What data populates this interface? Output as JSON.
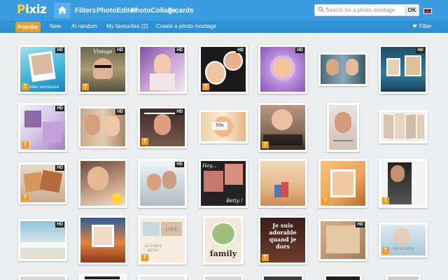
{
  "brand": {
    "logo_p": "P",
    "logo_rest": "ixiz"
  },
  "nav": {
    "links": [
      {
        "label": "Filters"
      },
      {
        "label": "PhotoEditor"
      },
      {
        "label": "PhotoCollage"
      },
      {
        "label": "E-cards"
      }
    ]
  },
  "search": {
    "placeholder": "Search for a photo montage",
    "button": "OK"
  },
  "subnav": {
    "popular": "Popular",
    "new": "New",
    "random": "At random",
    "favourites": "My favourites (2)",
    "create": "Create a photo montage",
    "filter": "Filter"
  },
  "thumbs": {
    "t1_text": "home vacances",
    "t2_text": "Vintage",
    "t10_text": "Me",
    "t17_text1": "Hey...",
    "t17_text2": "Betty !",
    "t24_text1": "LOVE",
    "t24_text2": "AT FIRST SIGHT",
    "t25_text": "family",
    "t26_text": "Je suis adorable quand je dors",
    "t28_text": "Alexandra"
  },
  "badges": {
    "hd": "HD",
    "t": "T"
  },
  "colors": {
    "topbar": "#3a9be0",
    "subbar": "#2f8fd3",
    "accent": "#f29b1d"
  }
}
